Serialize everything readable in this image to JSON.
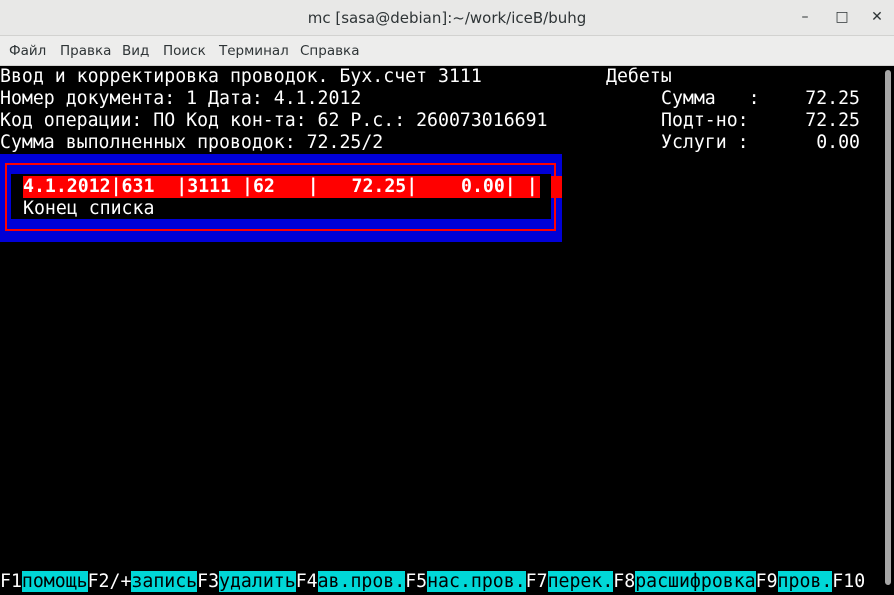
{
  "window": {
    "title": "mc [sasa@debian]:~/work/iceB/buhg",
    "minimize_glyph": "–",
    "maximize_glyph": "□",
    "close_glyph": "✕"
  },
  "menu": [
    "Файл",
    "Правка",
    "Вид",
    "Поиск",
    "Терминал",
    "Справка"
  ],
  "header": {
    "line1": "Ввод и корректировка проводок. Бух.счет 3111",
    "line2": "Номер документа: 1 Дата: 4.1.2012",
    "line3": "Код операции: ПО Код кон-та: 62 Р.с.: 260073016691",
    "line4": "Сумма выполненных проводок: 72.25/2"
  },
  "debits": {
    "title": "Дебеты",
    "rows": [
      {
        "label": "Сумма   :",
        "value": "72.25"
      },
      {
        "label": "Подт-но:",
        "value": "72.25"
      },
      {
        "label": "Услуги :",
        "value": "0.00"
      }
    ]
  },
  "list": {
    "selected_row": "4.1.2012|631  |3111 |62   |   72.25|    0.00| |",
    "end_text": "Конец списка"
  },
  "fkeys": [
    {
      "key": "F1",
      "label": "помощь"
    },
    {
      "key": "F2/+",
      "label": "запись"
    },
    {
      "key": "F3",
      "label": "удалить"
    },
    {
      "key": "F4",
      "label": "ав.пров."
    },
    {
      "key": "F5",
      "label": "нас.пров."
    },
    {
      "key": "F7",
      "label": "перек."
    },
    {
      "key": "F8",
      "label": "расшифровка"
    },
    {
      "key": "F9",
      "label": "пров."
    },
    {
      "key": "F10",
      "label": ""
    }
  ],
  "colors": {
    "terminal_bg": "#000000",
    "frame_blue": "#0000d7",
    "highlight_red": "#ff0000",
    "fkey_label_bg": "#00d7d7"
  }
}
